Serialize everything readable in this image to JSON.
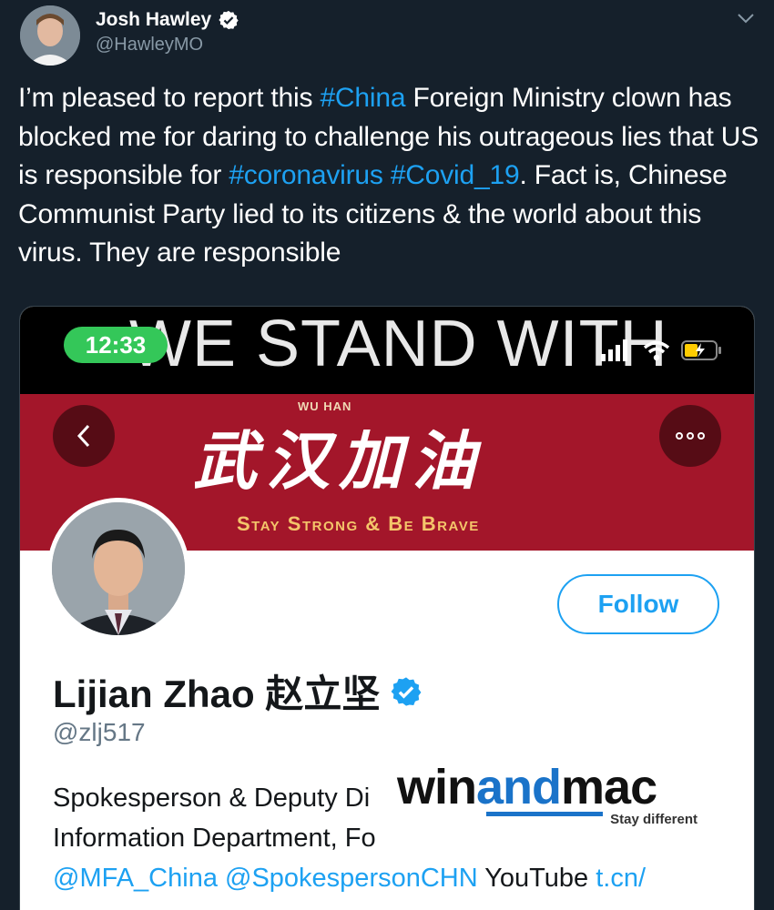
{
  "tweet": {
    "author_name": "Josh Hawley",
    "author_handle": "@HawleyMO",
    "text": {
      "t1": "I’m pleased to report this ",
      "h1": "#China",
      "t2": " Foreign Ministry clown has blocked me for daring to challenge his outrageous lies that US is responsible for ",
      "h2": "#coronavirus",
      "t3": " ",
      "h3": "#Covid_19",
      "t4": ". Fact is, Chinese Communist Party lied to its citizens & the world about this virus. They are responsible"
    }
  },
  "embedded": {
    "status_time": "12:33",
    "bg_banner_text": "WE STAND WITH",
    "banner_small": "WU HAN",
    "banner_chinese": "武汉加油",
    "banner_slogan": "Stay Strong & Be Brave",
    "follow_label": "Follow",
    "profile_name": "Lijian Zhao 赵立坚",
    "profile_handle": "@zlj517",
    "bio": {
      "line1": "Spokesperson & Deputy Di",
      "line2": "Information Department, Fo",
      "line3_link1": "@MFA_China",
      "line3_link2": "@SpokespersonCHN",
      "line3_text": " YouTube ",
      "line3_link3": "t.cn/"
    }
  },
  "watermark": {
    "brand_pre": "win",
    "brand_mid": "and",
    "brand_post": "mac",
    "tagline": "Stay different"
  },
  "colors": {
    "background": "#15202b",
    "link": "#1da1f2",
    "banner": "#a3162a",
    "status_pill": "#34c759"
  }
}
